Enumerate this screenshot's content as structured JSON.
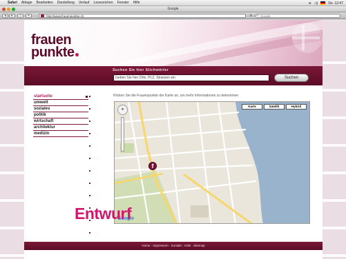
{
  "os_menubar": {
    "app_name": "Safari",
    "items": [
      "Ablage",
      "Bearbeiten",
      "Darstellung",
      "Verlauf",
      "Lesezeichen",
      "Fenster",
      "Hilfe"
    ],
    "clock": "Do. 12:47"
  },
  "browser": {
    "window_title": "Google",
    "url": "http://www.frauenpunkte.ch",
    "search_placeholder": "Google"
  },
  "site": {
    "logo_line1": "frauen",
    "logo_line2": "punkte",
    "search": {
      "title": "Suchen Sie hier Stichwörter",
      "input_value": "Geben Sie hier Orte, PLZ, Strassen ein",
      "button_label": "Suchen"
    },
    "nav": [
      {
        "label": "startseite",
        "active": true
      },
      {
        "label": "umwelt",
        "active": false
      },
      {
        "label": "soziales",
        "active": false
      },
      {
        "label": "politik",
        "active": false
      },
      {
        "label": "wirtschaft",
        "active": false
      },
      {
        "label": "architektur",
        "active": false
      },
      {
        "label": "medizin",
        "active": false
      }
    ],
    "hint": "Klicken Sie die Frauenpunkte der Karte an, um mehr Informationen zu bekommen",
    "map": {
      "type_buttons": [
        "Karte",
        "Satellit",
        "Hybrid"
      ],
      "attribution": "Google",
      "marker_label": "f"
    },
    "watermark": "Entwurf",
    "footer_text": "Home · Impressum · Kontakt · AGB · Sitemap"
  },
  "colors": {
    "brand": "#5c0a27",
    "accent": "#c2185b",
    "band": "#7a1736",
    "watermark": "#d0166d"
  }
}
